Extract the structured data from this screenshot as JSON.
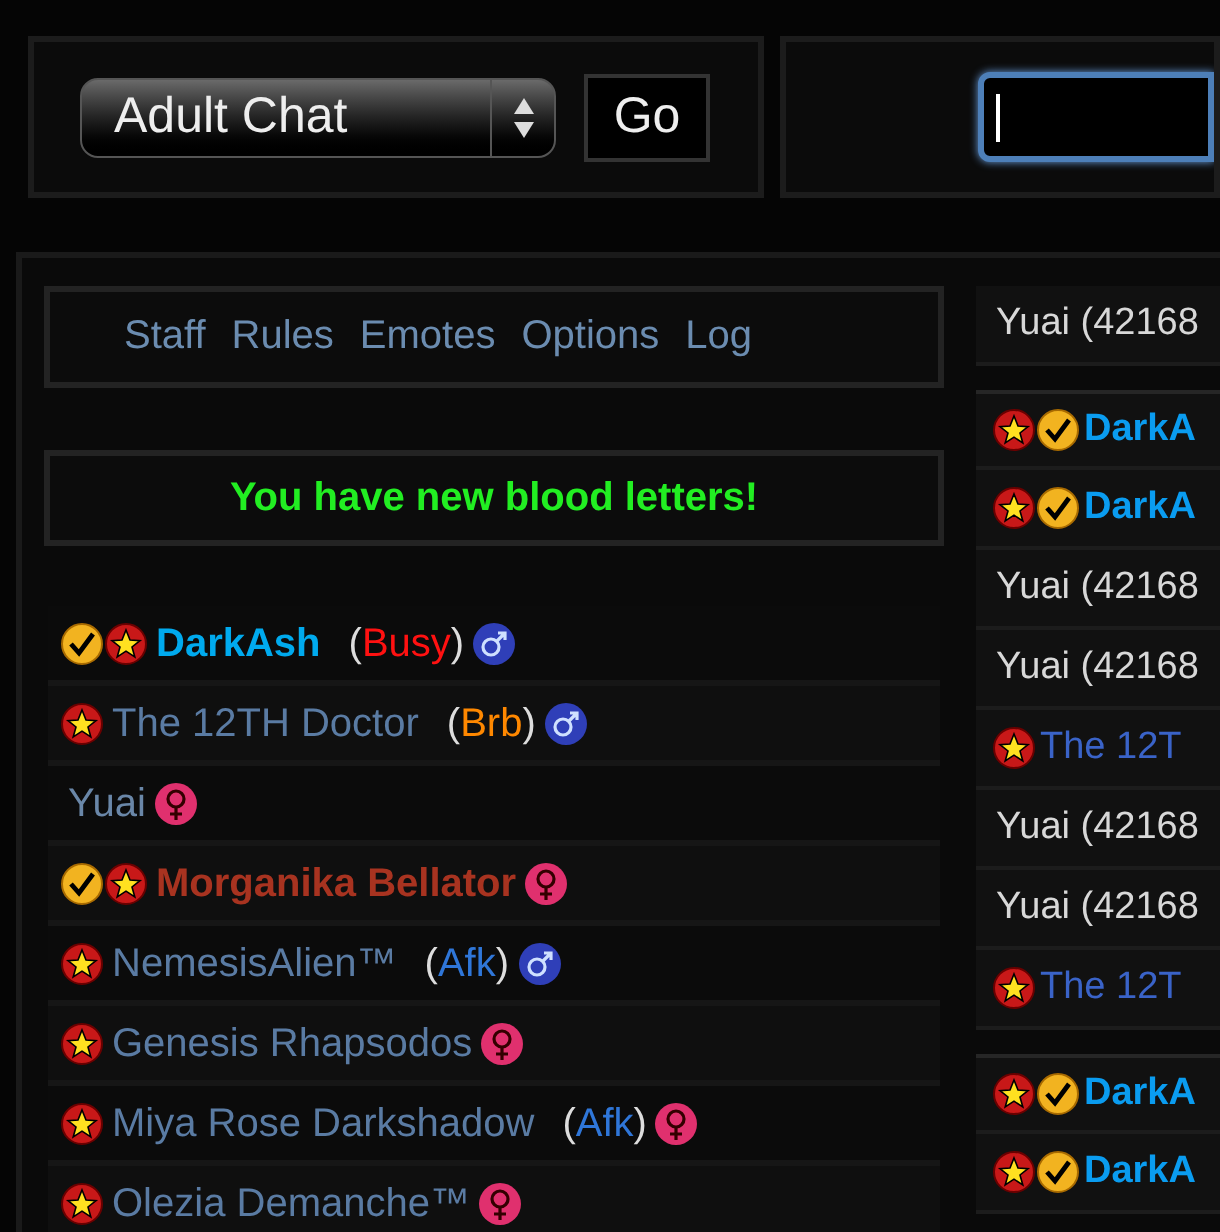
{
  "room_select": {
    "value": "Adult Chat"
  },
  "go_button": "Go",
  "message_field": {
    "focused": true
  },
  "nav": [
    "Staff",
    "Rules",
    "Emotes",
    "Options",
    "Log"
  ],
  "notice": "You have new blood letters!",
  "users": [
    {
      "badges": [
        {
          "kind": "check"
        },
        {
          "kind": "star"
        }
      ],
      "name": "DarkAsh",
      "color": "#00aaee",
      "bold": true,
      "status": {
        "open": "(",
        "label": "Busy",
        "close": ")",
        "color": "#ff1111"
      },
      "gender_icon": {
        "kind": "male"
      }
    },
    {
      "badges": [
        {
          "kind": "star"
        }
      ],
      "name": "The 12TH Doctor",
      "color": "#5a7ba3",
      "bold": false,
      "status": {
        "open": "(",
        "label": "Brb",
        "close": ")",
        "color": "#ff8800"
      },
      "gender_icon": {
        "kind": "male"
      }
    },
    {
      "name": "Yuai",
      "color": "#6a87a8",
      "bold": false,
      "gender_icon": {
        "kind": "female"
      }
    },
    {
      "badges": [
        {
          "kind": "check"
        },
        {
          "kind": "star"
        }
      ],
      "name": "Morganika Bellator",
      "color": "#a83320",
      "bold": true,
      "gender_icon": {
        "kind": "female"
      }
    },
    {
      "badges": [
        {
          "kind": "star"
        }
      ],
      "name": "NemesisAlien™",
      "color": "#5a7ba3",
      "bold": false,
      "status": {
        "open": "(",
        "label": "Afk",
        "close": ")",
        "color": "#2f76d8"
      },
      "gender_icon": {
        "kind": "male"
      }
    },
    {
      "badges": [
        {
          "kind": "star"
        }
      ],
      "name": "Genesis Rhapsodos",
      "color": "#5a7ba3",
      "bold": false,
      "gender_icon": {
        "kind": "female"
      }
    },
    {
      "badges": [
        {
          "kind": "star"
        }
      ],
      "name": "Miya Rose Darkshadow",
      "color": "#5a7ba3",
      "bold": false,
      "status": {
        "open": "(",
        "label": "Afk",
        "close": ")",
        "color": "#2f76d8"
      },
      "gender_icon": {
        "kind": "female"
      }
    },
    {
      "badges": [
        {
          "kind": "star"
        }
      ],
      "name": "Olezia Demanche™",
      "color": "#5a7ba3",
      "bold": false,
      "gender_icon": {
        "kind": "female"
      }
    }
  ],
  "messages": [
    {
      "name": "Yuai (42168",
      "color": "#d8d8d8",
      "bold": false,
      "separated": false
    },
    {
      "badges": [
        {
          "kind": "star"
        },
        {
          "kind": "check"
        }
      ],
      "name": "DarkA",
      "color": "#0a9cf0",
      "bold": true,
      "separated": true
    },
    {
      "badges": [
        {
          "kind": "star"
        },
        {
          "kind": "check"
        }
      ],
      "name": "DarkA",
      "color": "#0a9cf0",
      "bold": true,
      "separated": false
    },
    {
      "name": "Yuai (42168",
      "color": "#d8d8d8",
      "bold": false,
      "separated": false
    },
    {
      "name": "Yuai (42168",
      "color": "#d8d8d8",
      "bold": false,
      "separated": false
    },
    {
      "badges": [
        {
          "kind": "star"
        }
      ],
      "name": "The 12T",
      "color": "#3a63c8",
      "bold": false,
      "separated": false
    },
    {
      "name": "Yuai (42168",
      "color": "#d8d8d8",
      "bold": false,
      "separated": false
    },
    {
      "name": "Yuai (42168",
      "color": "#d8d8d8",
      "bold": false,
      "separated": false
    },
    {
      "badges": [
        {
          "kind": "star"
        }
      ],
      "name": "The 12T",
      "color": "#3a63c8",
      "bold": false,
      "separated": false
    },
    {
      "badges": [
        {
          "kind": "star"
        },
        {
          "kind": "check"
        }
      ],
      "name": "DarkA",
      "color": "#0a9cf0",
      "bold": true,
      "separated": true
    },
    {
      "badges": [
        {
          "kind": "star"
        },
        {
          "kind": "check"
        }
      ],
      "name": "DarkA",
      "color": "#0a9cf0",
      "bold": true,
      "separated": false
    }
  ]
}
